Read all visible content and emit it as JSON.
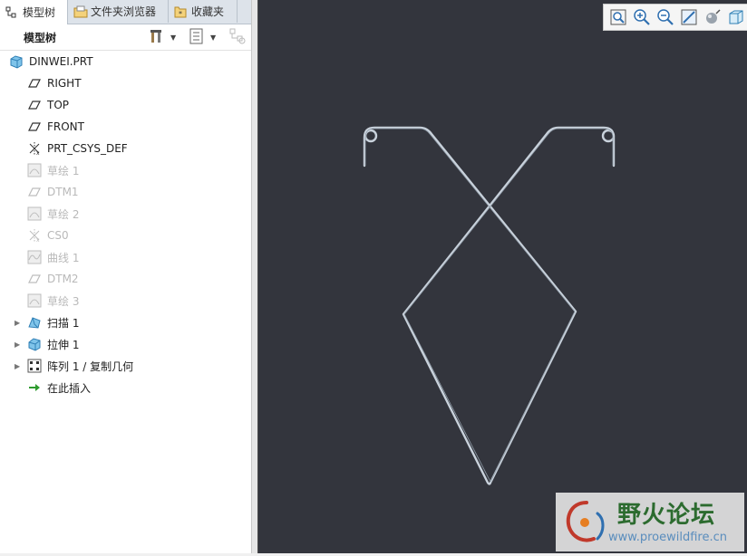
{
  "tabs": [
    {
      "label": "模型树",
      "icon": "model-tree-icon",
      "active": true
    },
    {
      "label": "文件夹浏览器",
      "icon": "folder-browser-icon",
      "active": false
    },
    {
      "label": "收藏夹",
      "icon": "favorites-icon",
      "active": false
    }
  ],
  "tree_panel": {
    "title": "模型树"
  },
  "tree": {
    "root": {
      "label": "DINWEI.PRT",
      "icon": "part-icon"
    },
    "items": [
      {
        "label": "RIGHT",
        "icon": "datum-plane-icon",
        "dim": false,
        "expandable": false
      },
      {
        "label": "TOP",
        "icon": "datum-plane-icon",
        "dim": false,
        "expandable": false
      },
      {
        "label": "FRONT",
        "icon": "datum-plane-icon",
        "dim": false,
        "expandable": false
      },
      {
        "label": "PRT_CSYS_DEF",
        "icon": "csys-icon",
        "dim": false,
        "expandable": false
      },
      {
        "label": "草绘 1",
        "icon": "sketch-icon",
        "dim": true,
        "expandable": false
      },
      {
        "label": "DTM1",
        "icon": "datum-plane-icon",
        "dim": true,
        "expandable": false
      },
      {
        "label": "草绘 2",
        "icon": "sketch-icon",
        "dim": true,
        "expandable": false
      },
      {
        "label": "CS0",
        "icon": "csys-icon",
        "dim": true,
        "expandable": false
      },
      {
        "label": "曲线 1",
        "icon": "curve-icon",
        "dim": true,
        "expandable": false
      },
      {
        "label": "DTM2",
        "icon": "datum-plane-icon",
        "dim": true,
        "expandable": false
      },
      {
        "label": "草绘 3",
        "icon": "sketch-icon",
        "dim": true,
        "expandable": false
      },
      {
        "label": "扫描 1",
        "icon": "sweep-icon",
        "dim": false,
        "expandable": true
      },
      {
        "label": "拉伸 1",
        "icon": "extrude-icon",
        "dim": false,
        "expandable": true
      },
      {
        "label": "阵列 1 / 复制几何",
        "icon": "pattern-icon",
        "dim": false,
        "expandable": true
      },
      {
        "label": "在此插入",
        "icon": "insert-here-arrow-icon",
        "dim": false,
        "expandable": false
      }
    ]
  },
  "view_toolbar": [
    "refit-icon",
    "zoom-in-icon",
    "zoom-out-icon",
    "repaint-icon",
    "display-style-icon",
    "saved-views-icon"
  ],
  "watermark": {
    "title": "野火论坛",
    "url": "www.proewildfire.cn"
  },
  "colors": {
    "viewport_bg": "#33353d",
    "wire": "#c9d2dc",
    "dim_text": "#b9b9b9",
    "watermark_green": "#2c6b2f"
  }
}
